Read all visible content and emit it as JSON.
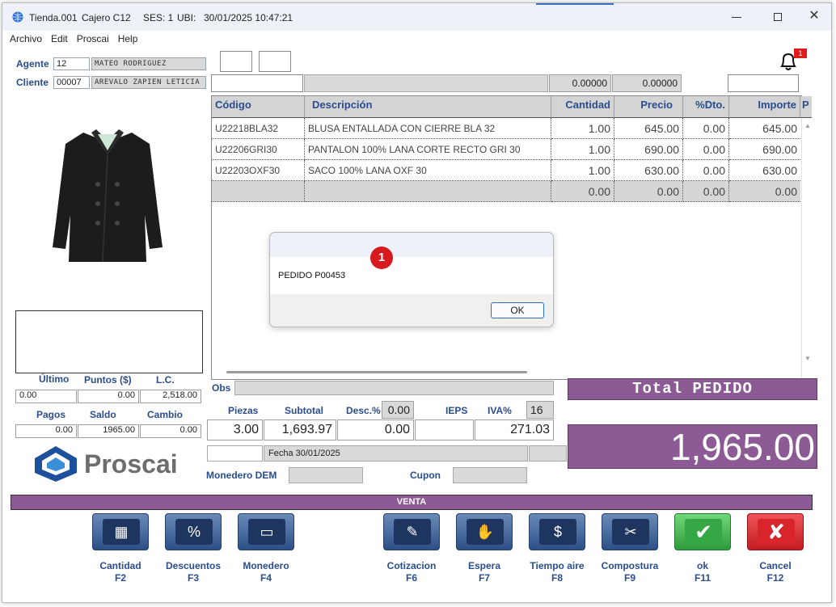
{
  "titlebar": {
    "app": "Tienda.001",
    "cashier": "Cajero C12",
    "session": "SES: 1",
    "ubi": "UBI:",
    "datetime": "30/01/2025 10:47:21"
  },
  "menu": [
    "Archivo",
    "Edit",
    "Proscai",
    "Help"
  ],
  "header": {
    "agente_label": "Agente",
    "agente_code": "12",
    "agente_name": "MATEO RODRIGUEZ",
    "cliente_label": "Cliente",
    "cliente_code": "00007",
    "cliente_name": "AREVALO ZAPIEN LETICIA",
    "notif_count": "1"
  },
  "toprow": {
    "v1": "0.00000",
    "v2": "0.00000"
  },
  "grid": {
    "columns": [
      "Código",
      "Descripción",
      "Cantidad",
      "Precio",
      "%Dto.",
      "Importe",
      "P"
    ],
    "rows": [
      {
        "codigo": "U22218BLA32",
        "desc": "BLUSA ENTALLADA CON CIERRE BLA 32",
        "cant": "1.00",
        "precio": "645.00",
        "dto": "0.00",
        "importe": "645.00"
      },
      {
        "codigo": "U22206GRI30",
        "desc": "PANTALON 100% LANA  CORTE RECTO GRI 30",
        "cant": "1.00",
        "precio": "690.00",
        "dto": "0.00",
        "importe": "690.00"
      },
      {
        "codigo": "U22203OXF30",
        "desc": "SACO 100% LANA OXF 30",
        "cant": "1.00",
        "precio": "630.00",
        "dto": "0.00",
        "importe": "630.00"
      }
    ],
    "totals": {
      "cant": "0.00",
      "precio": "0.00",
      "dto": "0.00",
      "importe": "0.00"
    }
  },
  "dialog": {
    "badge": "1",
    "message": "PEDIDO P00453",
    "ok": "OK"
  },
  "stats": {
    "ultimo_label": "Último",
    "puntos_label": "Puntos ($)",
    "lc_label": "L.C.",
    "ultimo": "0.00",
    "puntos": "0.00",
    "lc": "2,518.00",
    "pagos_label": "Pagos",
    "saldo_label": "Saldo",
    "cambio_label": "Cambio",
    "pagos": "0.00",
    "saldo": "1965.00",
    "cambio": "0.00"
  },
  "brand": "Proscai",
  "summary": {
    "obs_label": "Obs",
    "piezas_label": "Piezas",
    "subtotal_label": "Subtotal",
    "desc_label": "Desc.%",
    "desc_pct": "0.00",
    "ieps_label": "IEPS",
    "iva_label": "IVA%",
    "iva_pct": "16",
    "piezas": "3.00",
    "subtotal": "1,693.97",
    "desc": "0.00",
    "ieps": "",
    "iva": "271.03",
    "fecha": "Fecha 30/01/2025",
    "monedero_label": "Monedero DEM",
    "cupon_label": "Cupon"
  },
  "total": {
    "label": "Total PEDIDO",
    "amount": "1,965.00"
  },
  "venta_bar": "VENTA",
  "buttons": [
    {
      "label": "Cantidad",
      "key": "F2"
    },
    {
      "label": "Descuentos",
      "key": "F3"
    },
    {
      "label": "Monedero",
      "key": "F4"
    },
    {
      "label": "Cotizacion",
      "key": "F6"
    },
    {
      "label": "Espera",
      "key": "F7"
    },
    {
      "label": "Tiempo aire",
      "key": "F8"
    },
    {
      "label": "Compostura",
      "key": "F9"
    },
    {
      "label": "ok",
      "key": "F11"
    },
    {
      "label": "Cancel",
      "key": "F12"
    }
  ],
  "colors": {
    "accent": "#8c5a94",
    "label_blue": "#2a4d8f",
    "ok_green": "#3fae4f",
    "cancel_red": "#d8242b"
  }
}
